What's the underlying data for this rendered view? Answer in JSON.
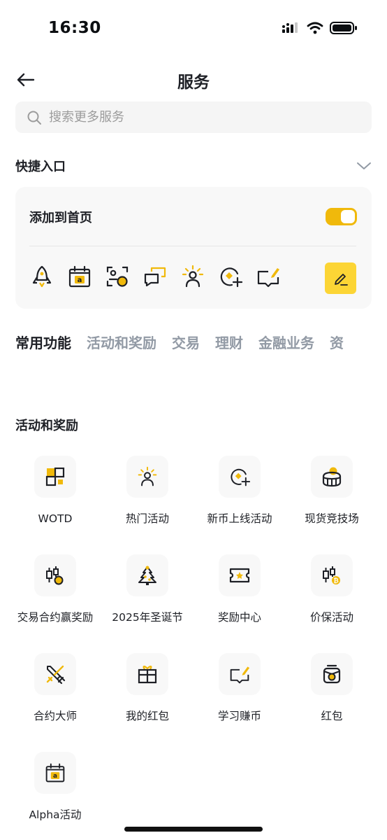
{
  "status_bar": {
    "time": "16:30"
  },
  "header": {
    "title": "服务"
  },
  "search": {
    "placeholder": "搜索更多服务"
  },
  "quick_entry": {
    "title": "快捷入口",
    "add_to_home_label": "添加到首页",
    "toggle_on": true,
    "icons": [
      "rocket-icon",
      "calendar-alpha-icon",
      "scan-coin-icon",
      "chat-bubble-icon",
      "sun-person-icon",
      "coin-plus-icon",
      "book-edit-icon"
    ]
  },
  "tabs": [
    "常用功能",
    "活动和奖励",
    "交易",
    "理财",
    "金融业务",
    "资"
  ],
  "activities": {
    "title": "活动和奖励",
    "items": [
      {
        "label": "WOTD",
        "icon": "wotd-icon"
      },
      {
        "label": "热门活动",
        "icon": "sun-person-icon"
      },
      {
        "label": "新币上线活动",
        "icon": "coin-plus-icon"
      },
      {
        "label": "现货竞技场",
        "icon": "arena-icon"
      },
      {
        "label": "交易合约赢奖励",
        "icon": "candle-icon"
      },
      {
        "label": "2025年圣诞节",
        "icon": "christmas-tree-icon"
      },
      {
        "label": "奖励中心",
        "icon": "ticket-icon"
      },
      {
        "label": "价保活动",
        "icon": "candle-coin-icon"
      },
      {
        "label": "合约大师",
        "icon": "swords-icon"
      },
      {
        "label": "我的红包",
        "icon": "gift-icon"
      },
      {
        "label": "学习赚币",
        "icon": "book-edit-icon"
      },
      {
        "label": "红包",
        "icon": "red-packet-icon"
      },
      {
        "label": "Alpha活动",
        "icon": "calendar-alpha-icon"
      }
    ]
  },
  "colors": {
    "accent": "#F0B90B",
    "accent_light": "#FCD535",
    "text": "#1E2026",
    "muted": "#929AA5",
    "tile_bg": "#F8F8F8"
  }
}
